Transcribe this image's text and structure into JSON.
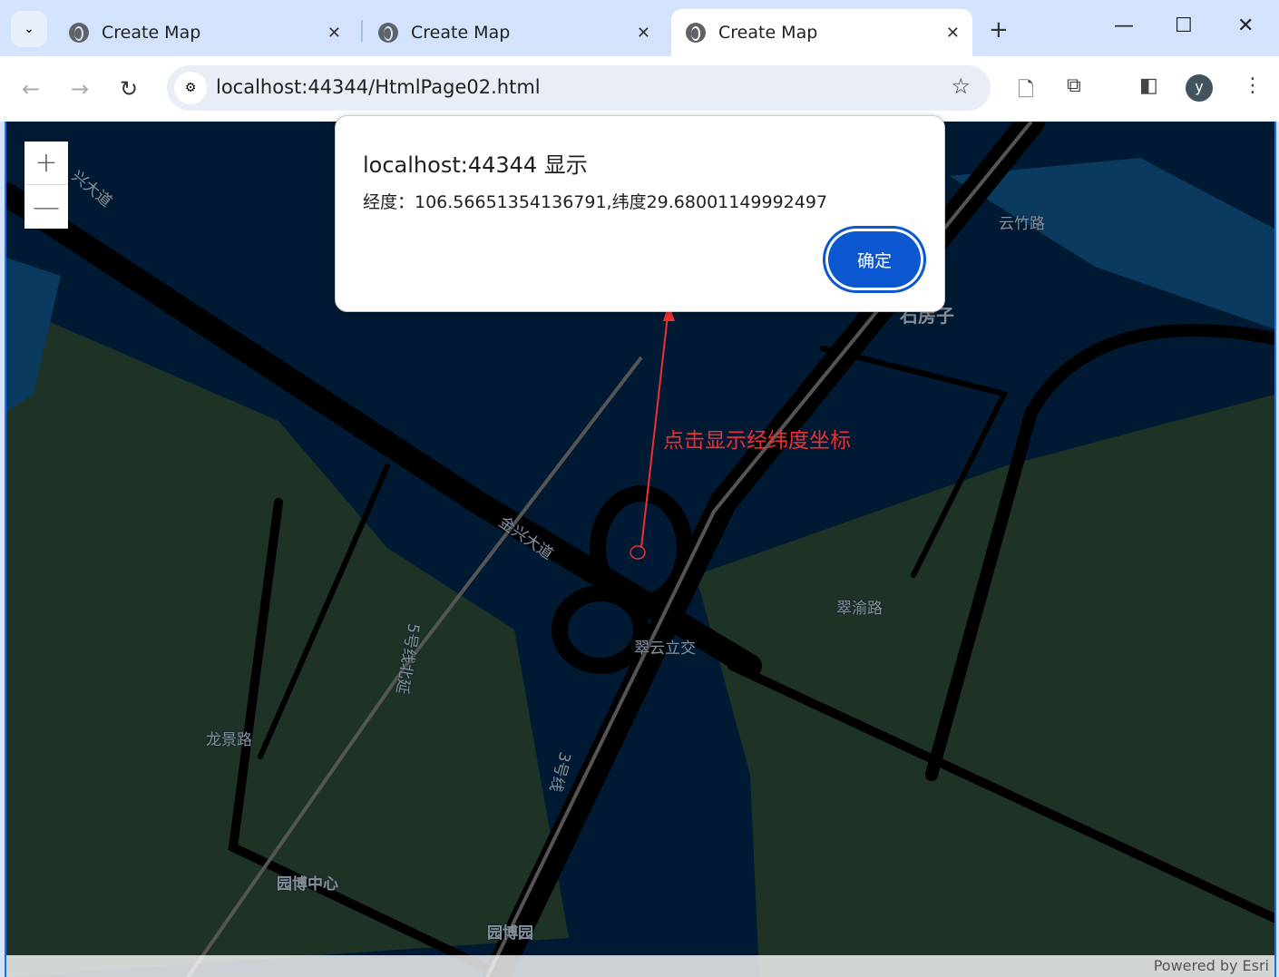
{
  "browser": {
    "tabs": [
      {
        "title": "Create Map",
        "active": false
      },
      {
        "title": "Create Map",
        "active": false
      },
      {
        "title": "Create Map",
        "active": true
      }
    ],
    "close_glyph": "✕",
    "new_tab_glyph": "+",
    "url": "localhost:44344/HtmlPage02.html",
    "profile_initial": "y"
  },
  "map": {
    "zoom_in": "+",
    "zoom_out": "—",
    "attribution": "Powered by Esri",
    "labels": [
      "兴大道",
      "云竹路",
      "石房子",
      "金兴大道",
      "5号线北延",
      "翠云立交",
      "翠渝路",
      "3号线",
      "龙景路",
      "园博中心",
      "园博园"
    ]
  },
  "dialog": {
    "title": "localhost:44344 显示",
    "message": "经度：106.56651354136791,纬度29.68001149992497",
    "ok_label": "确定"
  },
  "annotation": {
    "text": "点击显示经纬度坐标",
    "color": "#f03030"
  },
  "colors": {
    "map_water": "#001a33",
    "map_land": "#1e3226",
    "road": "#000000",
    "accent": "#0b57d0"
  }
}
